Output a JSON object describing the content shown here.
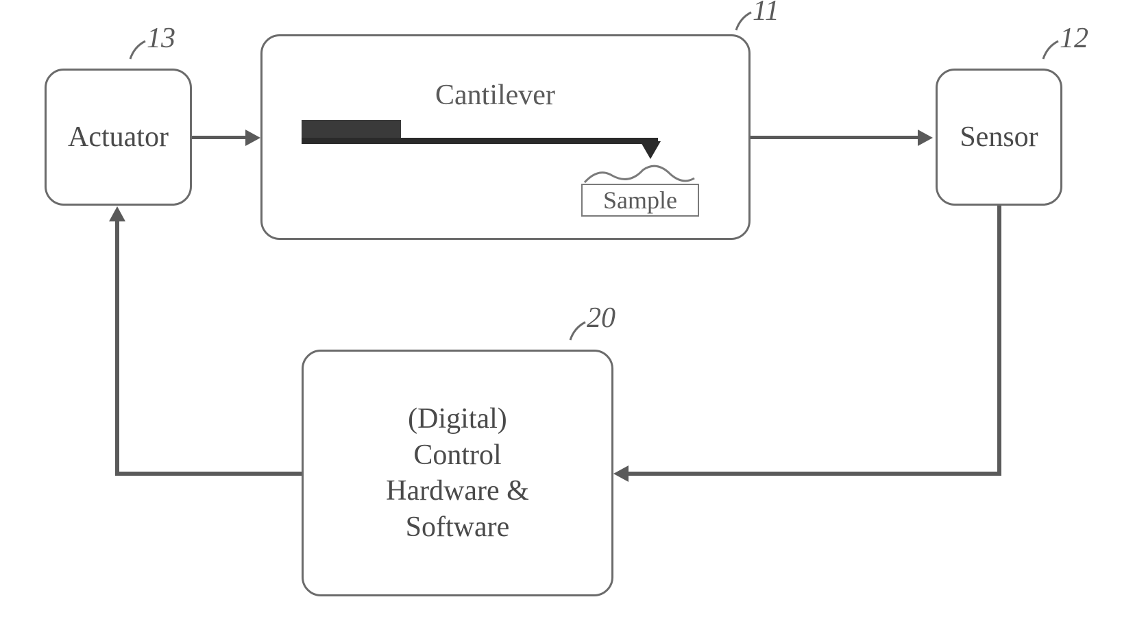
{
  "blocks": {
    "actuator": {
      "ref": "13",
      "label": "Actuator"
    },
    "cantilever_block": {
      "ref": "11",
      "cantilever_label": "Cantilever",
      "sample_label": "Sample"
    },
    "sensor": {
      "ref": "12",
      "label": "Sensor"
    },
    "controller": {
      "ref": "20",
      "line1": "(Digital)",
      "line2": "Control",
      "line3": "Hardware &",
      "line4": "Software"
    }
  }
}
